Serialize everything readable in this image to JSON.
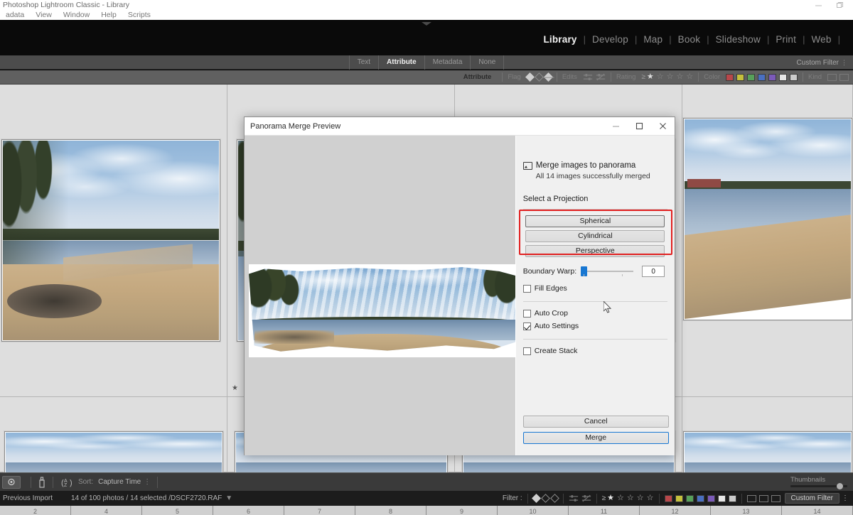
{
  "os": {
    "title": "Photoshop Lightroom Classic - Library",
    "window_buttons": [
      "minimize-icon",
      "restore-icon"
    ]
  },
  "menubar": {
    "items": [
      "adata",
      "View",
      "Window",
      "Help",
      "Scripts"
    ]
  },
  "lightroom": {
    "modules": [
      {
        "label": "Library",
        "active": true
      },
      {
        "label": "Develop",
        "active": false
      },
      {
        "label": "Map",
        "active": false
      },
      {
        "label": "Book",
        "active": false
      },
      {
        "label": "Slideshow",
        "active": false
      },
      {
        "label": "Print",
        "active": false
      },
      {
        "label": "Web",
        "active": false
      }
    ],
    "filter_tabs": [
      {
        "label": "Text",
        "active": false
      },
      {
        "label": "Attribute",
        "active": true
      },
      {
        "label": "Metadata",
        "active": false
      },
      {
        "label": "None",
        "active": false
      }
    ],
    "custom_filter_top": "Custom Filter",
    "attribute_row": {
      "attribute_label": "Attribute",
      "flag_label": "Flag",
      "edits_label": "Edits",
      "rating_label": "Rating",
      "rating_operator": "≥",
      "rating_value": 1,
      "rating_max": 5,
      "color_label": "Color",
      "kind_label": "Kind",
      "color_chips": [
        "#b94b4b",
        "#c6c23a",
        "#58a martial",
        "#4a6fc0",
        "#7a59b8",
        "#e8e8e8",
        "#cccccc"
      ],
      "color_chips_hex": [
        "#b8474a",
        "#c5c03c",
        "#5aa martial",
        "#4a6fc0",
        "#7b5ab8",
        "#e6e6e6",
        "#cbcbcb"
      ]
    }
  },
  "grid": {
    "cells": [
      {
        "name": "photo-beach-path",
        "star": false
      },
      {
        "name": "photo-lake-left",
        "star": true
      },
      {
        "name": "photo-lake-right",
        "star": false
      }
    ]
  },
  "toolbar": {
    "sort_label": "Sort:",
    "sort_value": "Capture Time",
    "az_label": "A\nZ",
    "thumbnails_label": "Thumbnails"
  },
  "filmstrip_header": {
    "source": "Previous Import",
    "count_text": "14 of 100 photos /",
    "selected_text": "14 selected",
    "filename": "/DSCF2720.RAF",
    "filter_label": "Filter :",
    "rating_operator": "≥",
    "rating_value": 1,
    "custom_filter": "Custom Filter"
  },
  "filmstrip": {
    "numbers": [
      "2",
      "4",
      "5",
      "6",
      "7",
      "8",
      "9",
      "10",
      "11",
      "12",
      "13",
      "14"
    ]
  },
  "dialog": {
    "title": "Panorama Merge Preview",
    "window_buttons": [
      "minimize-icon",
      "maximize-icon",
      "close-icon"
    ],
    "header": "Merge images to panorama",
    "subheader": "All 14 images successfully merged",
    "section_label": "Select a Projection",
    "projections": [
      {
        "label": "Spherical",
        "selected": true
      },
      {
        "label": "Cylindrical",
        "selected": false
      },
      {
        "label": "Perspective",
        "selected": false
      }
    ],
    "boundary_warp": {
      "label": "Boundary Warp:",
      "value": "0"
    },
    "checkboxes": [
      {
        "label": "Fill Edges",
        "checked": false
      },
      {
        "label": "Auto Crop",
        "checked": false
      },
      {
        "label": "Auto Settings",
        "checked": true
      },
      {
        "label": "Create Stack",
        "checked": false
      }
    ],
    "buttons": [
      {
        "label": "Cancel",
        "primary": false
      },
      {
        "label": "Merge",
        "primary": true
      }
    ],
    "highlight_color": "#e12020",
    "accent_color": "#1877d2"
  }
}
